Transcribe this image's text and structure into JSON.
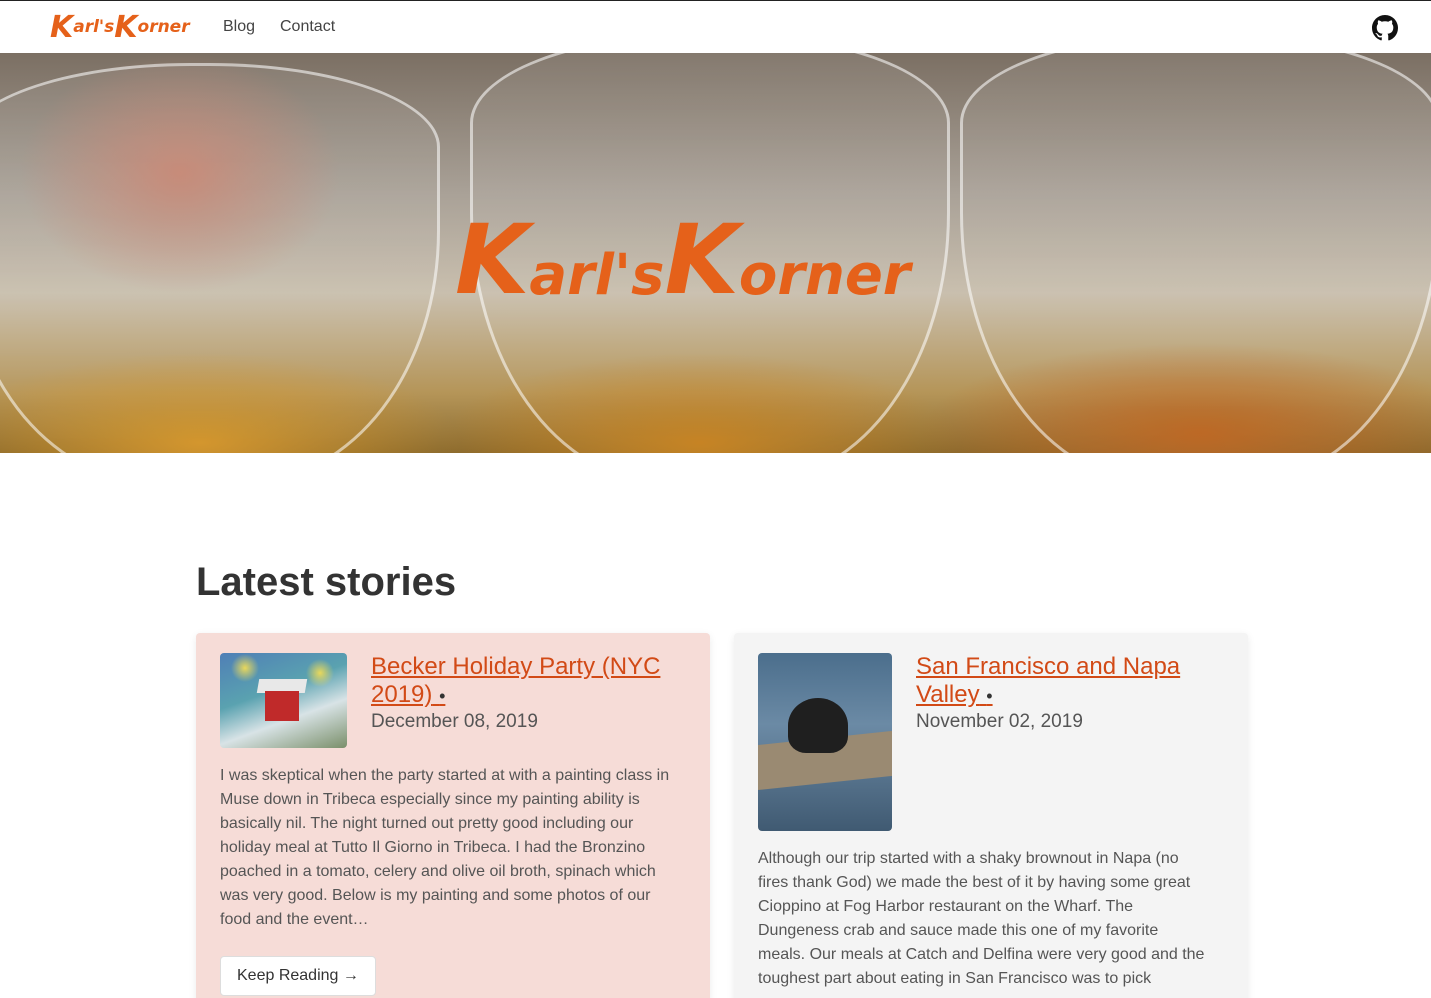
{
  "nav": {
    "brand_parts": [
      "K",
      "arl's",
      "K",
      "orner"
    ],
    "blog": "Blog",
    "contact": "Contact",
    "github_icon": "github-icon"
  },
  "hero": {
    "logo_parts": [
      "K",
      "arl's",
      "K",
      "orner"
    ]
  },
  "main": {
    "section_title": "Latest stories",
    "posts": [
      {
        "title": "Becker Holiday Party (NYC 2019)",
        "separator": "•",
        "date": "December 08, 2019",
        "excerpt": "I was skeptical when the party started at with a painting class in Muse down in Tribeca especially since my painting ability is basically nil. The night turned out pretty good including our holiday meal at Tutto Il Giorno in Tribeca. I had the Bronzino poached in a tomato, celery and olive oil broth, spinach which was very good. Below is my painting and some photos of our food and the event…",
        "cta": "Keep Reading →"
      },
      {
        "title": "San Francisco and Napa Valley",
        "separator": "•",
        "date": "November 02, 2019",
        "excerpt": "Although our trip started with a shaky brownout in Napa (no fires thank God) we made the best of it by having some great Cioppino at Fog Harbor restaurant on the Wharf. The Dungeness crab and sauce made this one of my favorite meals. Our meals at Catch and Delfina were very good and the toughest part about eating in San Francisco was to pick"
      }
    ]
  },
  "colors": {
    "brand": "#e5611a",
    "link": "#d24a16",
    "card1_bg": "#f6dcd7",
    "card2_bg": "#f4f4f4"
  }
}
